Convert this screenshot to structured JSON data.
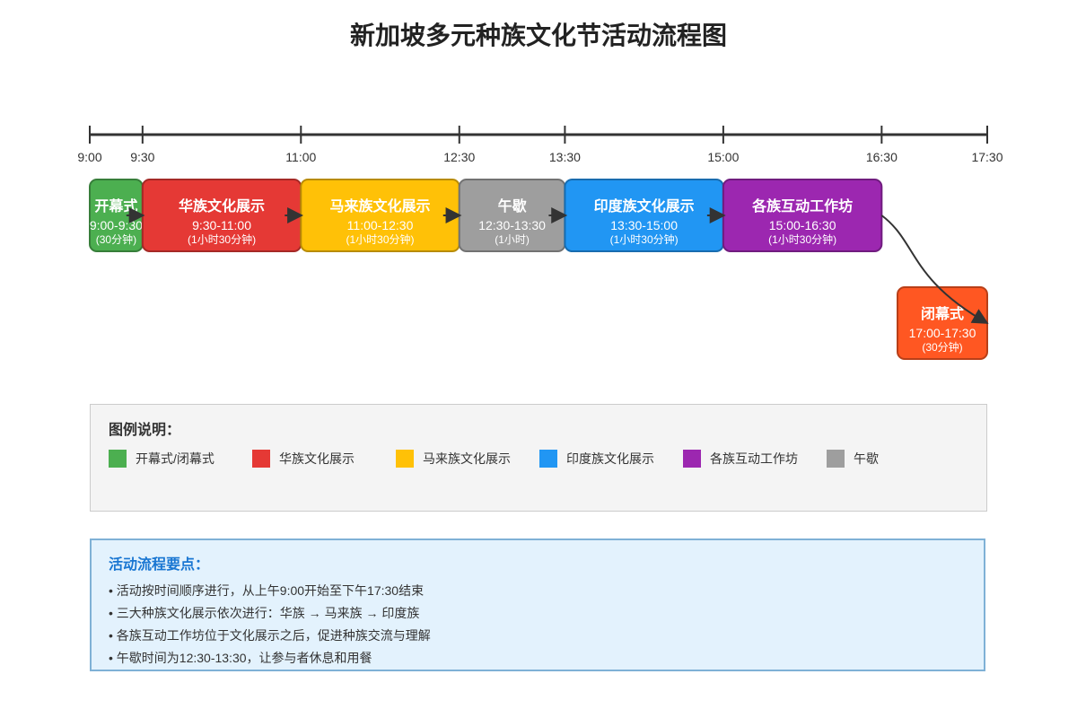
{
  "title": "新加坡多元种族文化节活动流程图",
  "colors": {
    "opening_closing": "#4caf50",
    "chinese": "#e53935",
    "malay": "#ffc107",
    "lunch": "#9e9e9e",
    "indian": "#2196f3",
    "workshop": "#9c27b0",
    "closing": "#ff5722"
  },
  "timeline": {
    "ticks": [
      "9:00",
      "9:30",
      "11:00",
      "12:30",
      "13:30",
      "15:00",
      "16:30",
      "17:30"
    ],
    "tick_minutes": [
      540,
      570,
      660,
      750,
      810,
      900,
      990,
      1050
    ]
  },
  "activities": [
    {
      "name": "开幕式",
      "time": "9:00-9:30",
      "duration": "(30分钟)",
      "category": "opening_closing",
      "start": 540,
      "end": 570
    },
    {
      "name": "华族文化展示",
      "time": "9:30-11:00",
      "duration": "(1小时30分钟)",
      "category": "chinese",
      "start": 570,
      "end": 660
    },
    {
      "name": "马来族文化展示",
      "time": "11:00-12:30",
      "duration": "(1小时30分钟)",
      "category": "malay",
      "start": 660,
      "end": 750
    },
    {
      "name": "午歇",
      "time": "12:30-13:30",
      "duration": "(1小时)",
      "category": "lunch",
      "start": 750,
      "end": 810
    },
    {
      "name": "印度族文化展示",
      "time": "13:30-15:00",
      "duration": "(1小时30分钟)",
      "category": "indian",
      "start": 810,
      "end": 900
    },
    {
      "name": "各族互动工作坊",
      "time": "15:00-16:30",
      "duration": "(1小时30分钟)",
      "category": "workshop",
      "start": 900,
      "end": 990
    },
    {
      "name": "闭幕式",
      "time": "17:00-17:30",
      "duration": "(30分钟)",
      "category": "closing",
      "start": 1020,
      "end": 1050
    }
  ],
  "legend": {
    "title": "图例说明：",
    "items": [
      {
        "label": "开幕式/闭幕式",
        "category": "opening_closing"
      },
      {
        "label": "华族文化展示",
        "category": "chinese"
      },
      {
        "label": "马来族文化展示",
        "category": "malay"
      },
      {
        "label": "印度族文化展示",
        "category": "indian"
      },
      {
        "label": "各族互动工作坊",
        "category": "workshop"
      },
      {
        "label": "午歇",
        "category": "lunch"
      }
    ]
  },
  "notes": {
    "title": "活动流程要点：",
    "items": [
      "• 活动按时间顺序进行，从上午9:00开始至下午17:30结束",
      "• 三大种族文化展示依次进行：华族 → 马来族 → 印度族",
      "• 各族互动工作坊位于文化展示之后，促进种族交流与理解",
      "• 午歇时间为12:30-13:30，让参与者休息和用餐"
    ]
  }
}
